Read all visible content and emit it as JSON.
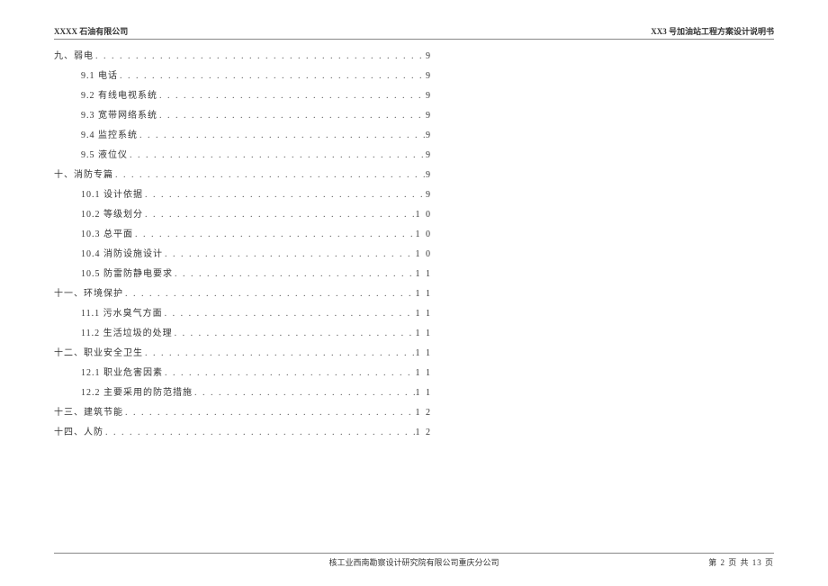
{
  "header": {
    "left": "XXXX 石油有限公司",
    "right": "XX3 号加油站工程方案设计说明书"
  },
  "dots": ". . . . . . . . . . . . . . . . . . . . . . . . . . . . . . . . . . . . . . . . . . . . . . . . . . . . . . . . . . . . . . . . . . . . . . . . . . . . . . . .",
  "toc": [
    {
      "level": 1,
      "label": "九、弱电",
      "page": "9"
    },
    {
      "level": 2,
      "label": "9.1 电话",
      "page": "9"
    },
    {
      "level": 2,
      "label": "9.2 有线电视系统",
      "page": "9"
    },
    {
      "level": 2,
      "label": "9.3 宽带网络系统",
      "page": "9"
    },
    {
      "level": 2,
      "label": "9.4 监控系统",
      "page": "9"
    },
    {
      "level": 2,
      "label": "9.5 液位仪",
      "page": "9"
    },
    {
      "level": 1,
      "label": "十、消防专篇",
      "page": "9"
    },
    {
      "level": 2,
      "label": "10.1 设计依据",
      "page": "9"
    },
    {
      "level": 2,
      "label": "10.2 等级划分",
      "page": "1 0"
    },
    {
      "level": 2,
      "label": "10.3 总平面",
      "page": "1 0"
    },
    {
      "level": 2,
      "label": "10.4 消防设施设计",
      "page": "1 0"
    },
    {
      "level": 2,
      "label": "10.5 防雷防静电要求",
      "page": "1 1"
    },
    {
      "level": 1,
      "label": "十一、环境保护",
      "page": "1 1"
    },
    {
      "level": 2,
      "label": "11.1 污水臭气方面",
      "page": "1 1"
    },
    {
      "level": 2,
      "label": "11.2 生活垃圾的处理",
      "page": "1 1"
    },
    {
      "level": 1,
      "label": "十二、职业安全卫生",
      "page": "1 1"
    },
    {
      "level": 2,
      "label": "12.1 职业危害因素",
      "page": "1 1"
    },
    {
      "level": 2,
      "label": "12.2 主要采用的防范措施",
      "page": "1 1"
    },
    {
      "level": 1,
      "label": "十三、建筑节能",
      "page": "1 2"
    },
    {
      "level": 1,
      "label": "十四、人防",
      "page": "1 2"
    }
  ],
  "footer": {
    "center": "核工业西南勘察设计研究院有限公司重庆分公司",
    "right": "第  2  页 共 13 页"
  }
}
